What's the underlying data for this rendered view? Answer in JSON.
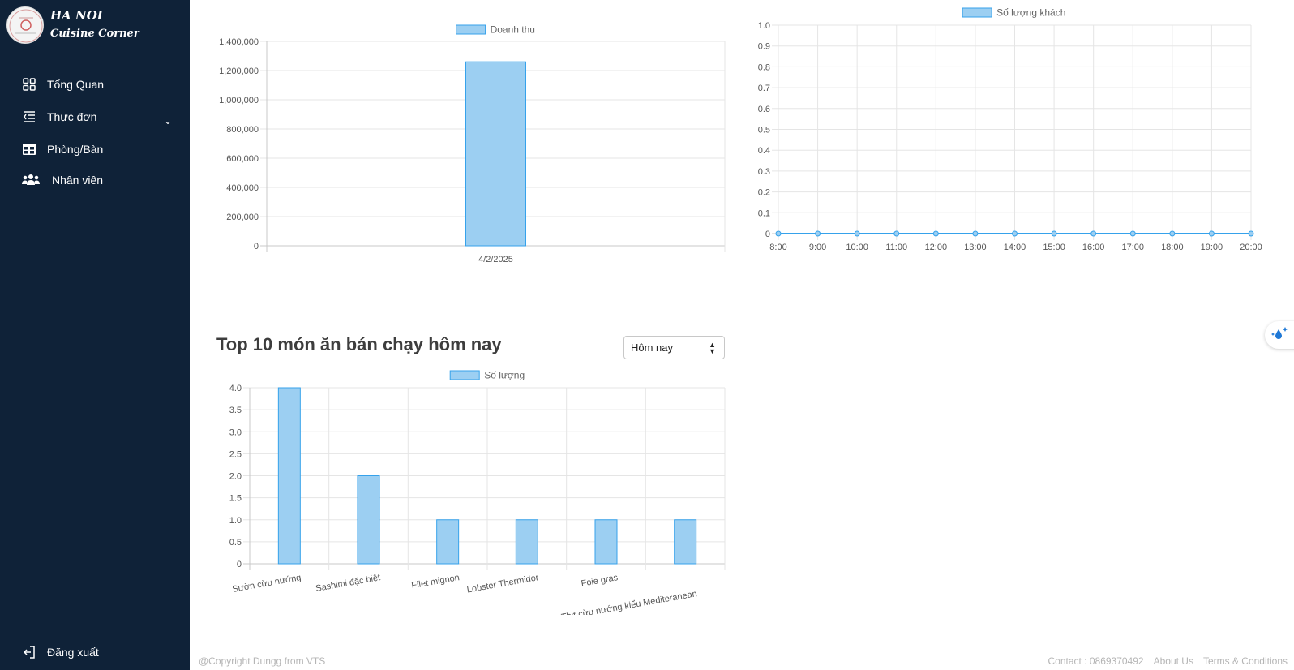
{
  "brand": {
    "line1": "HA NOI",
    "line2": "Cuisine Corner"
  },
  "nav": {
    "items": [
      {
        "label": "Tổng Quan",
        "icon": "grid-icon"
      },
      {
        "label": "Thực đơn",
        "icon": "menu-list-icon",
        "has_submenu": true
      },
      {
        "label": "Phòng/Bàn",
        "icon": "table-icon"
      },
      {
        "label": "Nhân viên",
        "icon": "users-icon"
      }
    ],
    "logout": {
      "label": "Đăng xuất",
      "icon": "logout-icon"
    }
  },
  "top_selling": {
    "title": "Top 10 món ăn bán chạy hôm nay",
    "filter_value": "Hôm nay"
  },
  "footer": {
    "copyright": "@Copyright Dungg from VTS",
    "contact": "Contact : 0869370492",
    "about": "About Us",
    "terms": "Terms & Conditions"
  },
  "colors": {
    "sidebar": "#0f2238",
    "bar_fill": "#9ccff2",
    "bar_stroke": "#36a2eb",
    "grid": "#e5e5e5"
  },
  "chart_data": [
    {
      "type": "bar",
      "categories": [
        "4/2/2025"
      ],
      "series": [
        {
          "name": "Doanh thu",
          "values": [
            1260000
          ]
        }
      ],
      "ylim": [
        0,
        1400000
      ],
      "yticks": [
        0,
        200000,
        400000,
        600000,
        800000,
        1000000,
        1200000,
        1400000
      ],
      "ytick_labels": [
        "0",
        "200,000",
        "400,000",
        "600,000",
        "800,000",
        "1,000,000",
        "1,200,000",
        "1,400,000"
      ],
      "legend": "top"
    },
    {
      "type": "line",
      "categories": [
        "8:00",
        "9:00",
        "10:00",
        "11:00",
        "12:00",
        "13:00",
        "14:00",
        "15:00",
        "16:00",
        "17:00",
        "18:00",
        "19:00",
        "20:00"
      ],
      "series": [
        {
          "name": "Số lượng khách",
          "values": [
            0,
            0,
            0,
            0,
            0,
            0,
            0,
            0,
            0,
            0,
            0,
            0,
            0
          ]
        }
      ],
      "ylim": [
        0,
        1.0
      ],
      "yticks": [
        0,
        0.1,
        0.2,
        0.3,
        0.4,
        0.5,
        0.6,
        0.7,
        0.8,
        0.9,
        1.0
      ],
      "ytick_labels": [
        "0",
        "0.1",
        "0.2",
        "0.3",
        "0.4",
        "0.5",
        "0.6",
        "0.7",
        "0.8",
        "0.9",
        "1.0"
      ],
      "legend": "top"
    },
    {
      "type": "bar",
      "categories": [
        "Sườn cừu nướng",
        "Sashimi đặc biệt",
        "Filet mignon",
        "Lobster Thermidor",
        "Foie gras",
        "Thịt cừu nướng kiểu Mediteranean"
      ],
      "series": [
        {
          "name": "Số lượng",
          "values": [
            4,
            2,
            1,
            1,
            1,
            1
          ]
        }
      ],
      "ylim": [
        0,
        4.0
      ],
      "yticks": [
        0,
        0.5,
        1.0,
        1.5,
        2.0,
        2.5,
        3.0,
        3.5,
        4.0
      ],
      "ytick_labels": [
        "0",
        "0.5",
        "1.0",
        "1.5",
        "2.0",
        "2.5",
        "3.0",
        "3.5",
        "4.0"
      ],
      "legend": "top"
    }
  ]
}
